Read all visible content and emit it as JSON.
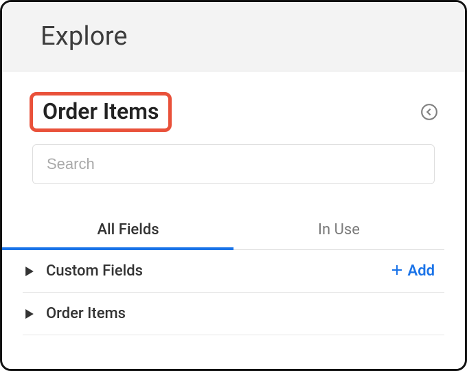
{
  "header": {
    "title": "Explore"
  },
  "panel": {
    "title": "Order Items",
    "highlight_color": "#e9513a",
    "collapse_icon": "chevron-left"
  },
  "search": {
    "placeholder": "Search",
    "value": ""
  },
  "tabs": {
    "items": [
      {
        "label": "All Fields",
        "active": true
      },
      {
        "label": "In Use",
        "active": false
      }
    ]
  },
  "sections": [
    {
      "label": "Custom Fields",
      "expanded": false,
      "has_add": true,
      "add_label": "Add"
    },
    {
      "label": "Order Items",
      "expanded": false,
      "has_add": false
    }
  ],
  "accent_color": "#1a73e8"
}
